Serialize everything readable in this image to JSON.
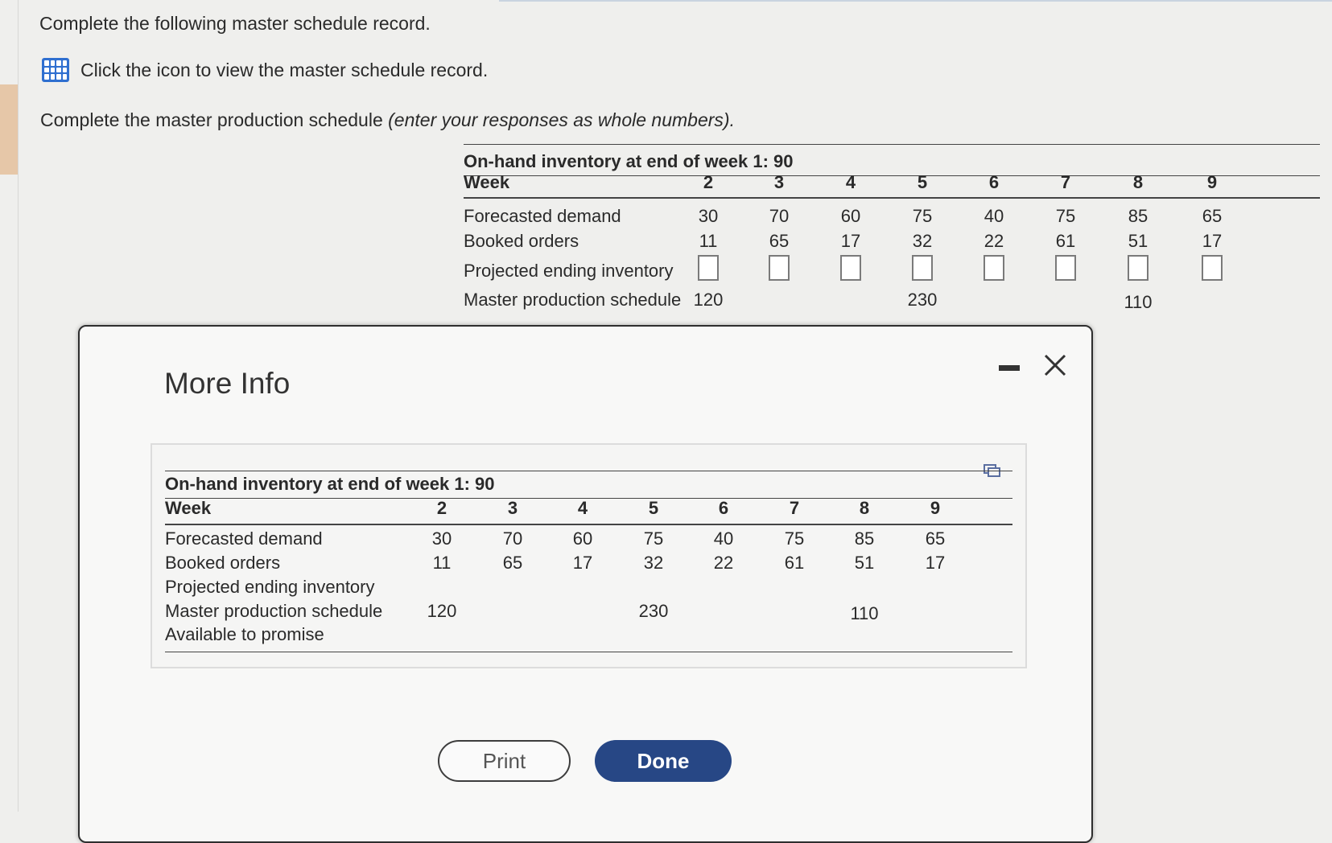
{
  "instructions": {
    "line1": "Complete the following master schedule record.",
    "icon_text": "Click the icon to view the master schedule record.",
    "line3_main": "Complete the master production schedule ",
    "line3_italic": "(enter your responses as whole numbers).",
    "icon": "grid-table-icon"
  },
  "schedule": {
    "title": "On-hand inventory at end of week 1: 90",
    "week_label": "Week",
    "weeks": [
      "2",
      "3",
      "4",
      "5",
      "6",
      "7",
      "8",
      "9"
    ],
    "forecast_label": "Forecasted demand",
    "forecast": [
      "30",
      "70",
      "60",
      "75",
      "40",
      "75",
      "85",
      "65"
    ],
    "booked_label": "Booked orders",
    "booked": [
      "11",
      "65",
      "17",
      "32",
      "22",
      "61",
      "51",
      "17"
    ],
    "projected_label": "Projected ending inventory",
    "projected": [
      "",
      "",
      "",
      "",
      "",
      "",
      "",
      ""
    ],
    "mps_label": "Master production schedule",
    "mps": [
      "120",
      "",
      "",
      "230",
      "",
      "",
      "110",
      ""
    ]
  },
  "modal": {
    "title": "More Info",
    "minimize_icon": "minimize-icon",
    "close_icon": "close-icon",
    "copy_icon": "copy-icon",
    "table": {
      "title": "On-hand inventory at end of week 1: 90",
      "week_label": "Week",
      "weeks": [
        "2",
        "3",
        "4",
        "5",
        "6",
        "7",
        "8",
        "9"
      ],
      "forecast_label": "Forecasted demand",
      "forecast": [
        "30",
        "70",
        "60",
        "75",
        "40",
        "75",
        "85",
        "65"
      ],
      "booked_label": "Booked orders",
      "booked": [
        "11",
        "65",
        "17",
        "32",
        "22",
        "61",
        "51",
        "17"
      ],
      "projected_label": "Projected ending inventory",
      "mps_label": "Master production schedule",
      "mps": [
        "120",
        "",
        "",
        "230",
        "",
        "",
        "110",
        ""
      ],
      "atp_label": "Available to promise"
    },
    "print_label": "Print",
    "done_label": "Done"
  },
  "colors": {
    "background": "#efefed",
    "done_button": "#274785",
    "icon_blue": "#2f6fd0"
  }
}
